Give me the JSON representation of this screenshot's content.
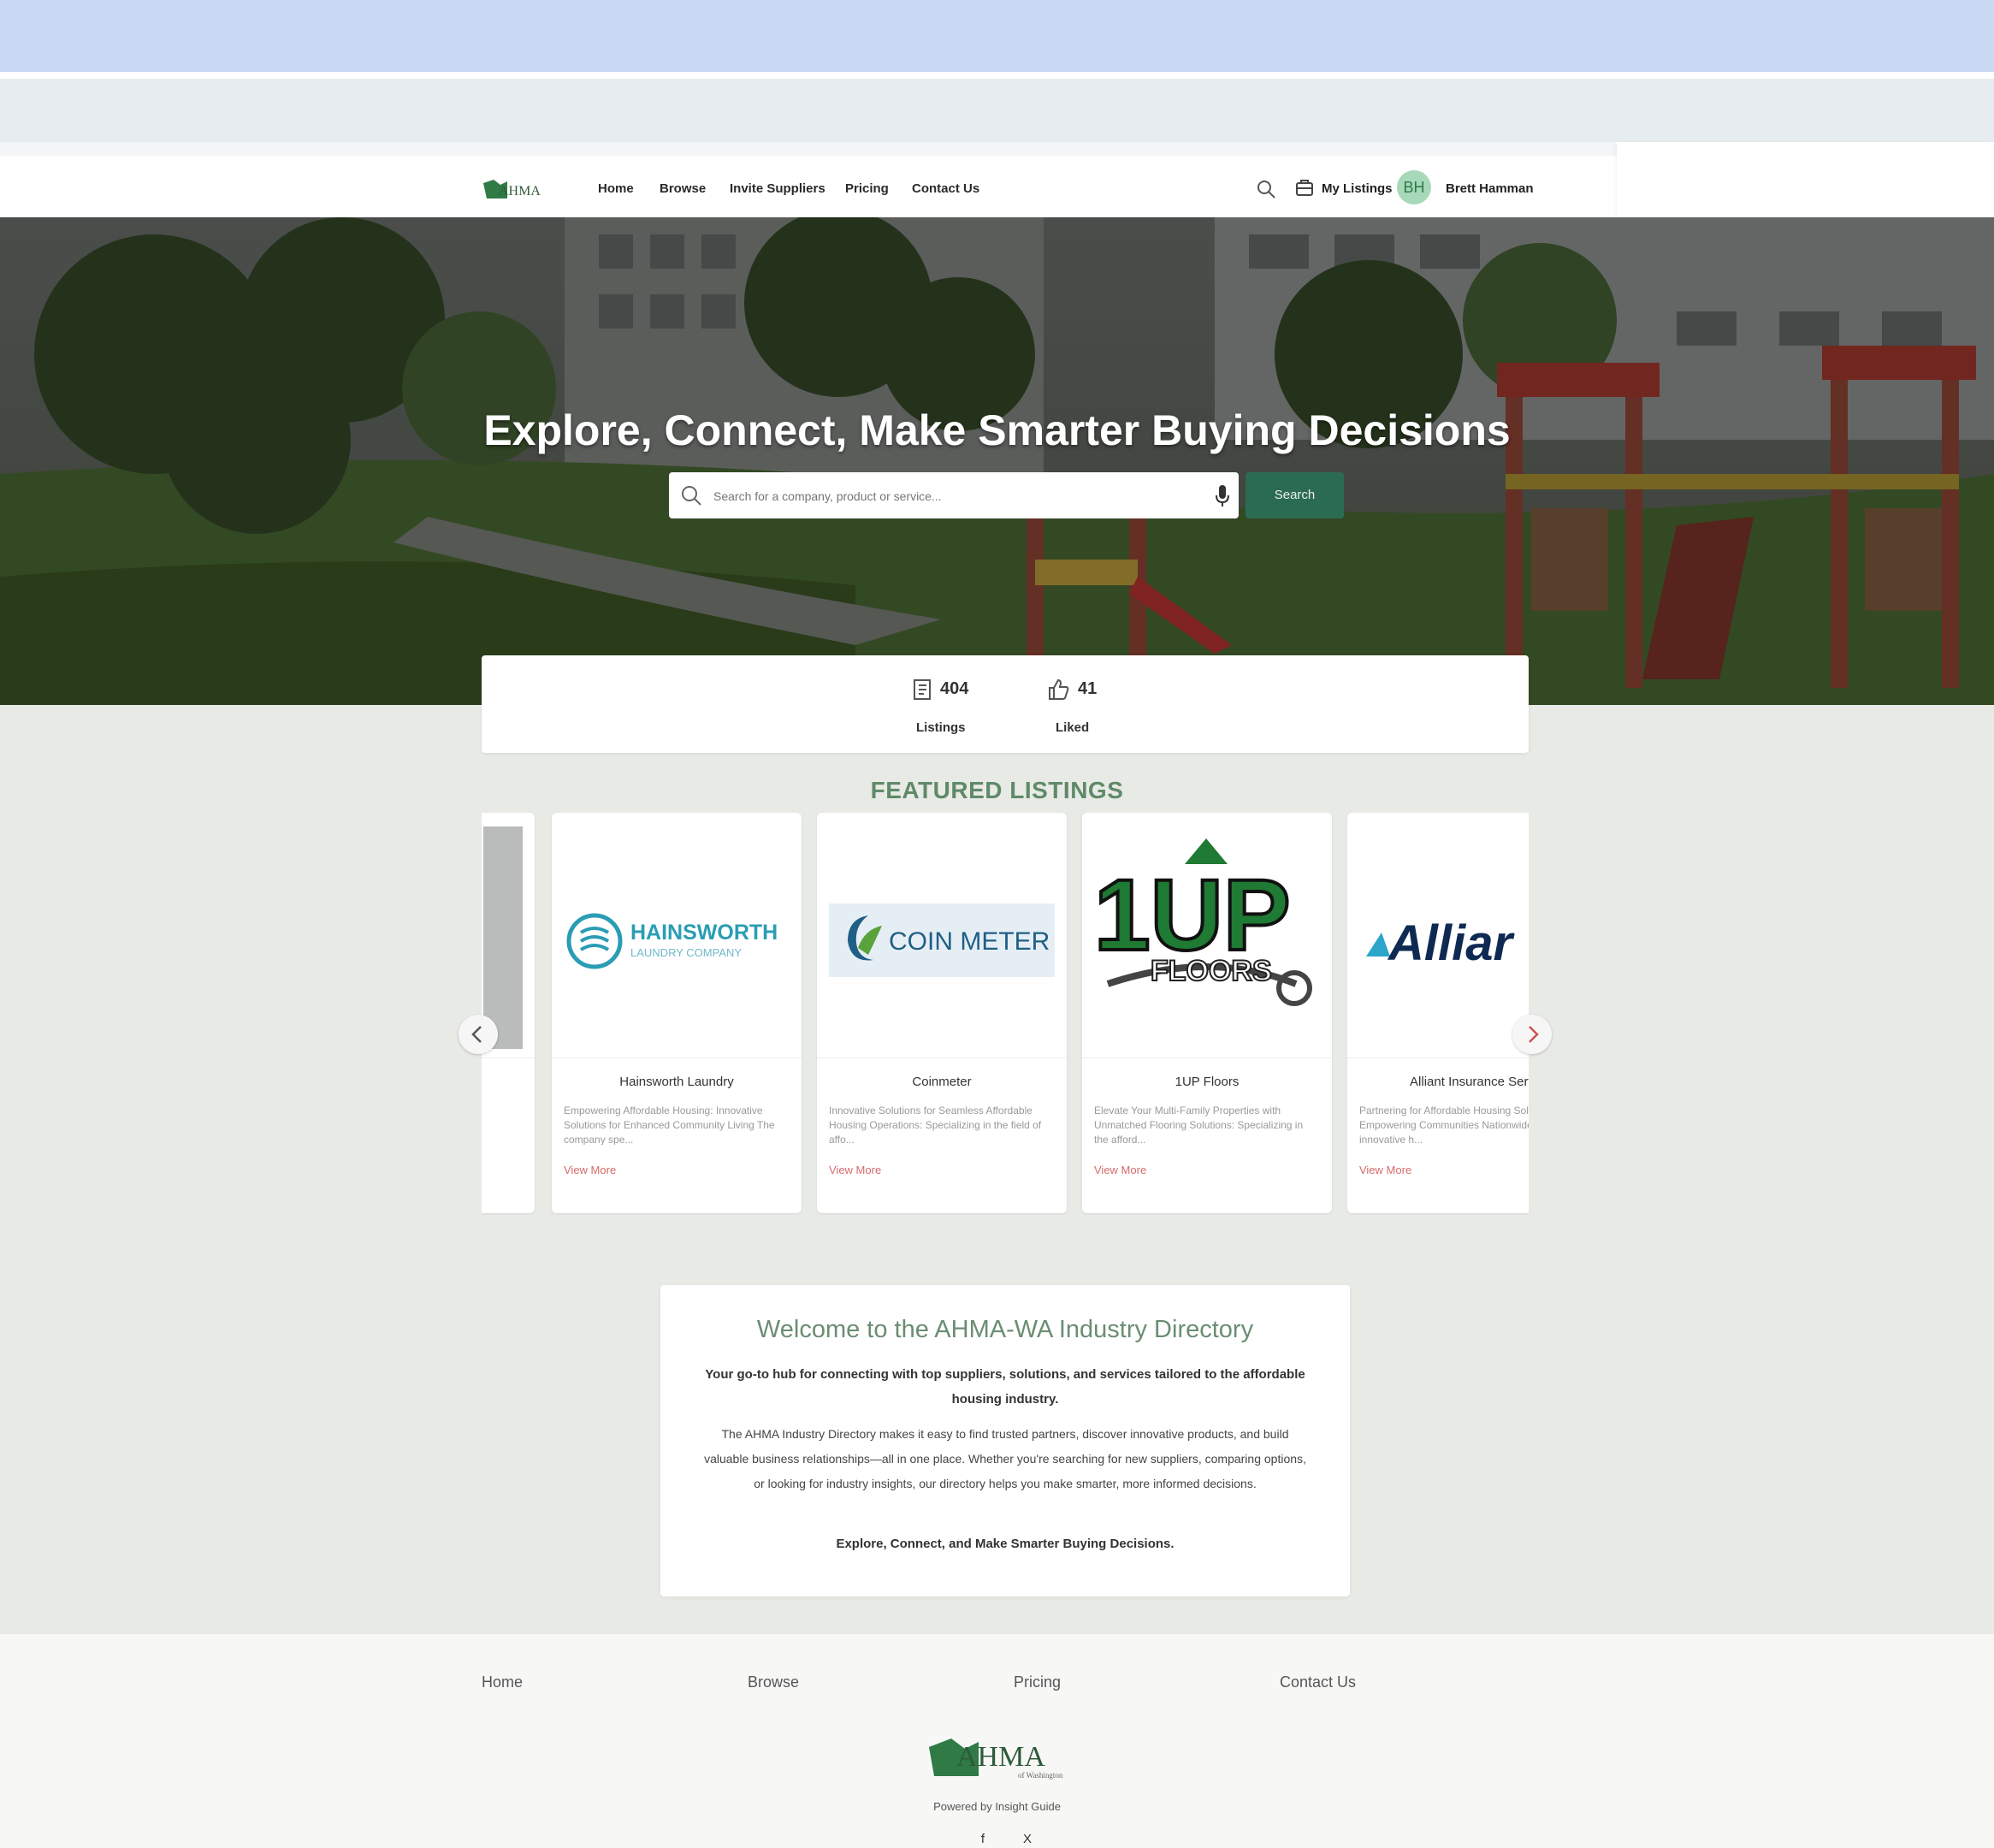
{
  "nav": {
    "logo_text": "AHMA",
    "links": [
      "Home",
      "Browse",
      "Invite Suppliers",
      "Pricing",
      "Contact Us"
    ],
    "my_listings": "My Listings",
    "avatar_initials": "BH",
    "user_name": "Brett Hamman"
  },
  "hero": {
    "title": "Explore, Connect, Make Smarter Buying Decisions",
    "search_placeholder": "Search for a company, product or service...",
    "search_button": "Search"
  },
  "stats": {
    "listings_value": "404",
    "listings_label": "Listings",
    "liked_value": "41",
    "liked_label": "Liked"
  },
  "featured": {
    "title": "FEATURED LISTINGS",
    "cards": [
      {
        "name": "Hainsworth Laundry",
        "logo_main": "HAINSWORTH",
        "logo_sub": "LAUNDRY COMPANY",
        "desc": "Empowering Affordable Housing: Innovative Solutions for Enhanced Community Living The company spe...",
        "more": "View More"
      },
      {
        "name": "Coinmeter",
        "logo_main": "COIN METER",
        "desc": "Innovative Solutions for Seamless Affordable Housing Operations: Specializing in the field of affo...",
        "more": "View More"
      },
      {
        "name": "1UP Floors",
        "logo_main": "1UP",
        "logo_sub": "FLOORS",
        "desc": "Elevate Your Multi-Family Properties with Unmatched Flooring Solutions: Specializing in the afford...",
        "more": "View More"
      },
      {
        "name": "Alliant Insurance Serv",
        "logo_main": "Alliar",
        "desc": "Partnering for Affordable Housing Solutions: Empowering Communities Nationwide This innovative h...",
        "more": "View More"
      }
    ]
  },
  "welcome": {
    "title": "Welcome to the AHMA-WA Industry Directory",
    "subtitle": "Your go-to hub for connecting with top suppliers, solutions, and services tailored to the affordable housing industry.",
    "body": "The AHMA Industry Directory makes it easy to find trusted partners, discover innovative products, and build valuable business relationships—all in one place. Whether you're searching for new suppliers, comparing options, or looking for industry insights, our directory helps you make smarter, more informed decisions.",
    "tagline": "Explore, Connect, and Make Smarter Buying Decisions."
  },
  "footer": {
    "links": [
      "Home",
      "Browse",
      "Pricing",
      "Contact Us"
    ],
    "logo_text": "AHMA",
    "logo_sub": "of Washington",
    "powered": "Powered by Insight Guide",
    "social": [
      "f",
      "X"
    ]
  },
  "colors": {
    "accent_green": "#2c6b53",
    "featured_title": "#5f8a68",
    "view_more": "#d56a6a",
    "avatar_bg": "#a7d9b8"
  },
  "icons": [
    "search-icon",
    "my-listings-icon",
    "microphone-icon",
    "listings-icon",
    "thumbs-up-icon",
    "chevron-left-icon",
    "chevron-right-icon",
    "facebook-icon",
    "x-icon"
  ]
}
